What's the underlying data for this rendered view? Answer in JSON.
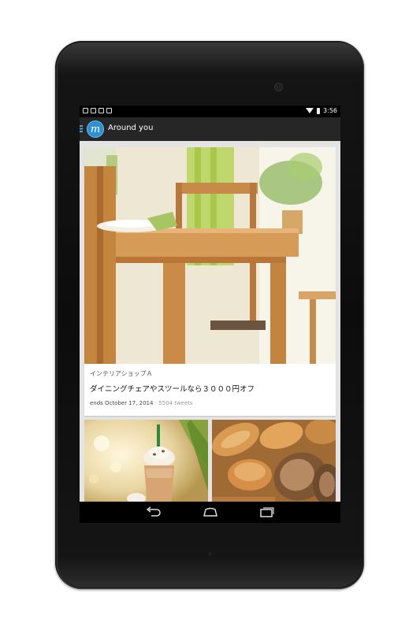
{
  "statusbar": {
    "time": "3:56",
    "icons": [
      "image-icon",
      "sd-card-icon",
      "gmail-icon",
      "calendar-icon"
    ],
    "wifi_icon": "wifi-icon",
    "battery_icon": "battery-icon"
  },
  "actionbar": {
    "title": "Around you",
    "logo_glyph": "m",
    "menu_icon": "menu-icon"
  },
  "featured_card": {
    "shop": "インテリアショップＡ",
    "title": "ダイニングチェアやスツールなら３０００円オフ",
    "ends": "ends October 17, 2014",
    "separator": " · ",
    "tweets": "5504 tweets"
  },
  "small_cards": [
    {
      "image": "coffee-frappuccino-photo"
    },
    {
      "image": "bread-assortment-photo"
    }
  ],
  "navbar": {
    "back_icon": "back-icon",
    "home_icon": "home-icon",
    "recents_icon": "recents-icon"
  },
  "colors": {
    "accent": "#2f8fd0",
    "actionbar": "#262626",
    "background": "#e4e4e4"
  }
}
